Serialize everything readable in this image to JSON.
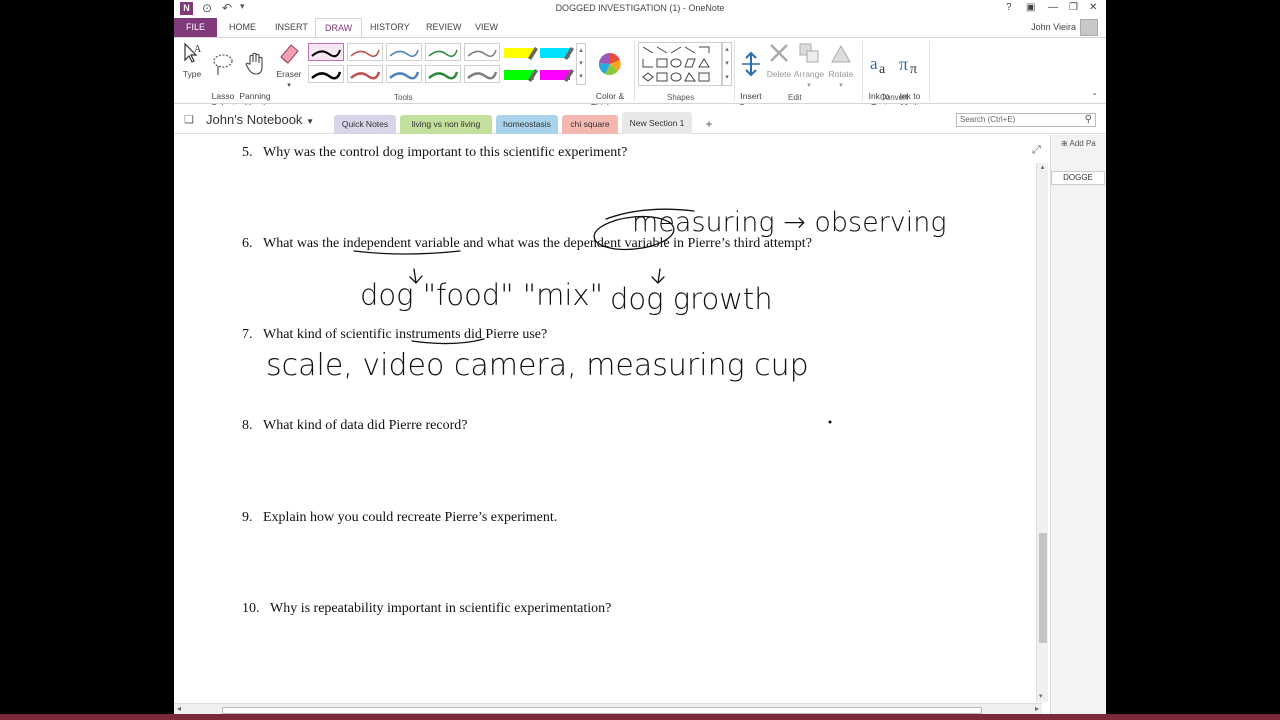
{
  "titlebar": {
    "title": "DOGGED INVESTIGATION (1) - OneNote",
    "user": "John Vieira",
    "help": "?",
    "minimize": "—",
    "restore": "❐",
    "close": "✕"
  },
  "ribbon_tabs": [
    {
      "label": "FILE"
    },
    {
      "label": "HOME"
    },
    {
      "label": "INSERT"
    },
    {
      "label": "DRAW"
    },
    {
      "label": "HISTORY"
    },
    {
      "label": "REVIEW"
    },
    {
      "label": "VIEW"
    }
  ],
  "ribbon": {
    "type": "Type",
    "lasso": "Lasso\nSelect",
    "panning": "Panning\nHand",
    "eraser": "Eraser",
    "color_thickness": "Color &\nThickness",
    "insert_space": "Insert\nSpace",
    "delete": "Delete",
    "arrange": "Arrange",
    "rotate": "Rotate",
    "ink_to_text": "Ink to\nText",
    "ink_to_math": "Ink to\nMath",
    "groups": {
      "tools": "Tools",
      "shapes": "Shapes",
      "edit": "Edit",
      "convert": "Convert"
    }
  },
  "pen_colors": [
    "#000000",
    "#c0504d",
    "#4f81bd",
    "#2e8b3e",
    "#7f7f7f",
    "#000000",
    "#c0504d",
    "#4f81bd",
    "#2e8b3e",
    "#7f7f7f"
  ],
  "highlighter_colors": [
    "#ffff00",
    "#00e0ff",
    "#00ff00",
    "#ff00ff"
  ],
  "notebook": {
    "name": "John's Notebook",
    "sections": [
      {
        "label": "Quick Notes",
        "color": "#d6d6e8"
      },
      {
        "label": "living vs non living",
        "color": "#c2df9b"
      },
      {
        "label": "homeostasis",
        "color": "#a9d3ea"
      },
      {
        "label": "chi square",
        "color": "#f4b8b0"
      },
      {
        "label": "New Section 1",
        "color": "#e8e8e8"
      }
    ],
    "add_section": "+",
    "search_placeholder": "Search (Ctrl+E)"
  },
  "questions": [
    {
      "number": "5.",
      "text": "Why was the control dog important to this scientific experiment?"
    },
    {
      "number": "6.",
      "text": "What was the independent variable and what was the dependent variable in Pierre’s third attempt?"
    },
    {
      "number": "7.",
      "text": "What kind of scientific instruments did Pierre use?"
    },
    {
      "number": "8.",
      "text": "What kind of data did Pierre record?"
    },
    {
      "number": "9.",
      "text": "Explain how you could recreate Pierre’s experiment."
    },
    {
      "number": "10.",
      "text": "Why is repeatability important in scientific experimentation?"
    }
  ],
  "handwriting": {
    "q6_top": "measuring → observing",
    "q6_left": "dog \"food\" \"mix\"",
    "q6_right": "dog growth",
    "q7": "scale, video camera, measuring cup"
  },
  "page_pane": {
    "add_page": "Add Pa",
    "page_tab": "DOGGE"
  }
}
